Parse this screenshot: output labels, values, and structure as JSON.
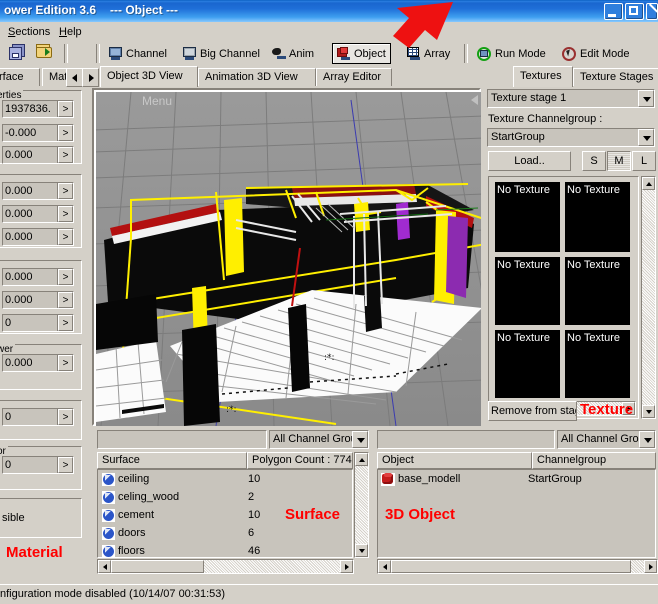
{
  "window": {
    "title": "ower Edition 3.6",
    "subtitle": "---  Object  ---",
    "minimize_label": "minimize",
    "maximize_label": "maximize",
    "close_label": "close"
  },
  "menubar": {
    "items": [
      {
        "label": "Sections"
      },
      {
        "label": "Help"
      }
    ]
  },
  "toolbar": {
    "save_label": "save",
    "open_label": "open",
    "buttons": [
      {
        "label": "Channel",
        "icon": "monitor-icon",
        "active": false
      },
      {
        "label": "Big Channel",
        "icon": "big-monitor-icon",
        "active": false
      },
      {
        "label": "Anim",
        "icon": "anim-icon",
        "active": false
      },
      {
        "label": "Object",
        "icon": "cube-icon",
        "active": true
      },
      {
        "label": "Array",
        "icon": "grid-icon",
        "active": false
      },
      {
        "label": "Run Mode",
        "icon": "run-icon",
        "active": false
      },
      {
        "label": "Edit Mode",
        "icon": "edit-icon",
        "active": false
      }
    ]
  },
  "tabrow": {
    "left_tabs": [
      {
        "label": "rface"
      },
      {
        "label": "Materia"
      }
    ],
    "scroll_left": "◄",
    "scroll_right": "►",
    "view_tabs": [
      {
        "label": "Object 3D View",
        "selected": true
      },
      {
        "label": "Animation 3D View",
        "selected": false
      },
      {
        "label": "Array Editor",
        "selected": false
      }
    ],
    "right_tabs": [
      {
        "label": "Textures",
        "selected": true
      },
      {
        "label": "Texture Stages",
        "selected": false
      }
    ]
  },
  "left_panel": {
    "groups": [
      {
        "label": "erties",
        "fields": [
          "1937836.",
          "-0.000",
          "0.000"
        ]
      },
      {
        "label": "",
        "fields": [
          "0.000",
          "0.000",
          "0.000"
        ]
      },
      {
        "label": "",
        "fields": [
          "0.000",
          "0.000",
          "0"
        ]
      },
      {
        "label": "wer",
        "fields": [
          "0.000"
        ]
      },
      {
        "label": "",
        "fields": [
          "0"
        ]
      },
      {
        "label": "or",
        "fields": [
          "0"
        ]
      }
    ],
    "checkbox_label": "sible",
    "annotation": "Material",
    "arrow_glyph": ">"
  },
  "viewport": {
    "menu_label": "Menu",
    "collapse_glyph": "◄"
  },
  "textures_panel": {
    "stage_combo_value": "Texture stage 1",
    "channelgroup_label": "Texture Channelgroup :",
    "channelgroup_combo_value": "StartGroup",
    "load_button": "Load..",
    "size_buttons": [
      {
        "label": "S",
        "pressed": false
      },
      {
        "label": "M",
        "pressed": true
      },
      {
        "label": "L",
        "pressed": false
      }
    ],
    "slots": [
      "No Texture",
      "No Texture",
      "No Texture",
      "No Texture",
      "No Texture",
      "No Texture"
    ],
    "remove_button": "Remove from stage",
    "annotation": "Texture"
  },
  "surface_list": {
    "filter_value": "",
    "group_combo_value": "All Channel Grou",
    "columns": [
      "Surface",
      "Polygon Count : 774"
    ],
    "rows": [
      {
        "name": "ceiling",
        "count": "10",
        "icon": "globe-icon",
        "selected": true
      },
      {
        "name": "celing_wood",
        "count": "2",
        "icon": "globe-icon",
        "selected": true
      },
      {
        "name": "cement",
        "count": "10",
        "icon": "globe-icon",
        "selected": true
      },
      {
        "name": "doors",
        "count": "6",
        "icon": "globe-icon",
        "selected": true
      },
      {
        "name": "floors",
        "count": "46",
        "icon": "globe-icon",
        "selected": true
      }
    ],
    "annotation": "Surface"
  },
  "object_list": {
    "filter_value": "",
    "group_combo_value": "All Channel Grou",
    "columns": [
      "Object",
      "Channelgroup"
    ],
    "rows": [
      {
        "name": "base_modell",
        "group": "StartGroup",
        "icon": "red-cube-icon",
        "selected": true
      }
    ],
    "annotation": "3D Object"
  },
  "statusbar": {
    "text": "nfiguration mode disabled (10/14/07 00:31:53)"
  },
  "colors": {
    "annotation_red": "#ff0000",
    "title_blue": "#1f6fd8",
    "face": "#d4d0c8"
  }
}
